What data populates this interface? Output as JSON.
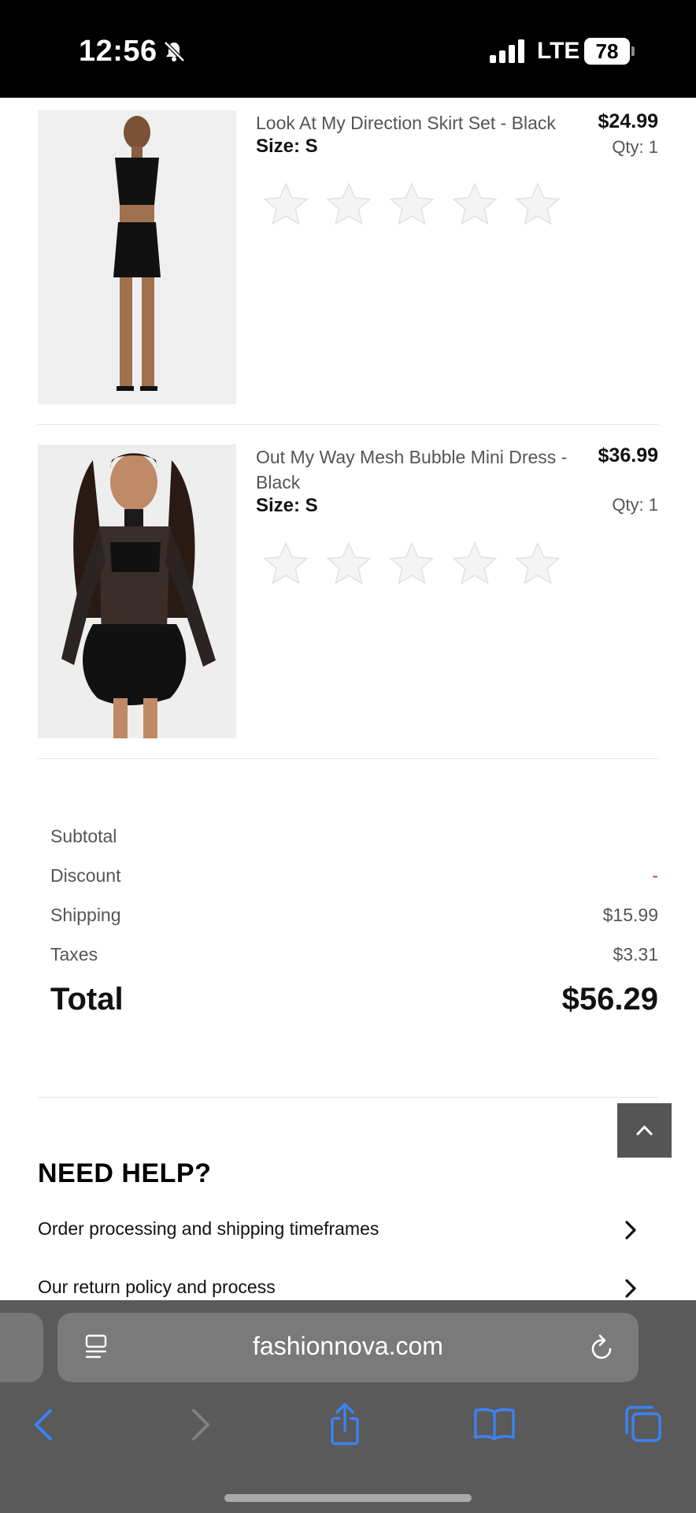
{
  "status": {
    "time": "12:56",
    "network": "LTE",
    "battery": "78"
  },
  "products": [
    {
      "title": "Look At My Direction Skirt Set - Black",
      "price": "$24.99",
      "size": "Size: S",
      "qty": "Qty: 1",
      "rating": 0
    },
    {
      "title": "Out My Way Mesh Bubble Mini Dress - Black",
      "price": "$36.99",
      "size": "Size: S",
      "qty": "Qty: 1",
      "rating": 0
    }
  ],
  "summary": {
    "subtotal_label": "Subtotal",
    "subtotal_value": "",
    "discount_label": "Discount",
    "discount_value": "-",
    "shipping_label": "Shipping",
    "shipping_value": "$15.99",
    "taxes_label": "Taxes",
    "taxes_value": "$3.31",
    "total_label": "Total",
    "total_value": "$56.29"
  },
  "help": {
    "title": "NEED HELP?",
    "links": [
      "Order processing and shipping timeframes",
      "Our return policy and process"
    ]
  },
  "browser": {
    "url": "fashionnova.com"
  },
  "icons": {
    "bell": "bell-slash-icon",
    "signal": "cellular-signal-icon",
    "back_top": "chevron-up-icon",
    "reader": "reader-icon",
    "reload": "reload-icon",
    "back": "back-arrow-icon",
    "forward": "forward-arrow-icon",
    "share": "share-icon",
    "bookmarks": "bookmarks-icon",
    "tabs": "tabs-icon"
  },
  "colors": {
    "accent": "#3b82f6",
    "discount": "#c0392b",
    "toolbar_bg": "#5a5a5a"
  }
}
